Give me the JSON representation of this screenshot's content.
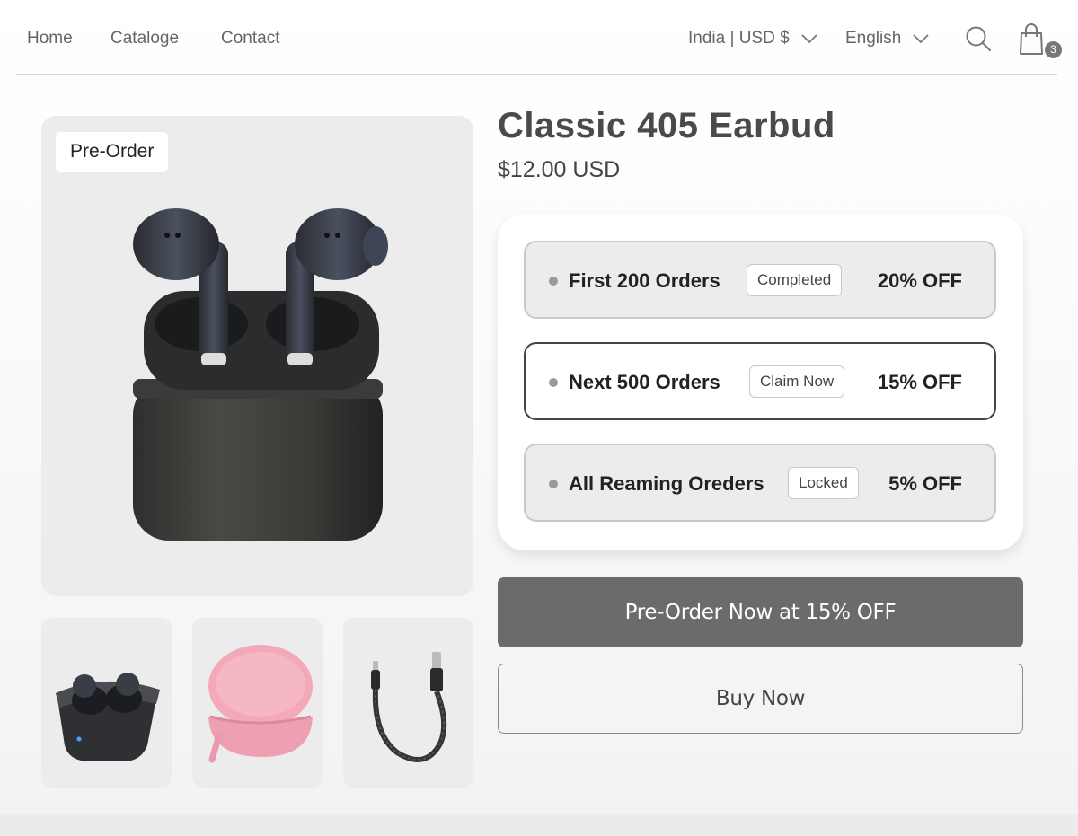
{
  "nav": {
    "links": [
      "Home",
      "Cataloge",
      "Contact"
    ],
    "region_label": "India | USD $",
    "language_label": "English",
    "cart_count": "3"
  },
  "gallery": {
    "badge": "Pre-Order",
    "thumbnails": [
      "black-earbuds-case",
      "pink-zip-case",
      "braided-usb-cable"
    ]
  },
  "product": {
    "title": "Classic 405 Earbud",
    "price": "$12.00 USD"
  },
  "tiers": [
    {
      "label": "First 200 Orders",
      "status": "Completed",
      "discount": "20% OFF"
    },
    {
      "label": "Next 500 Orders",
      "status": "Claim Now",
      "discount": "15% OFF"
    },
    {
      "label": "All Reaming Oreders",
      "status": "Locked",
      "discount": "5% OFF"
    }
  ],
  "actions": {
    "preorder_label": "Pre-Order Now at 15% OFF",
    "buy_label": "Buy Now"
  },
  "colors": {
    "primary_button": "#6b6b6b",
    "tier_inactive_bg": "#ececec",
    "tier_active_border": "#444444"
  }
}
